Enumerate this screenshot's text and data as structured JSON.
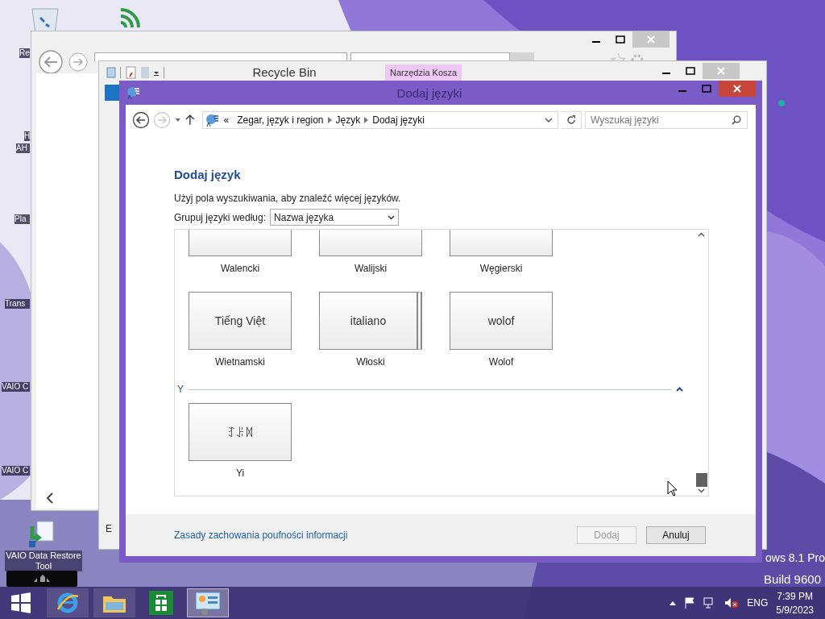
{
  "desktop": {
    "icons": [
      {
        "label": "Re"
      },
      {
        "label": "H"
      },
      {
        "label": "AH"
      },
      {
        "label": "Pla"
      },
      {
        "label": "Trans"
      },
      {
        "label": "VAIO C"
      },
      {
        "label": "VAIO C"
      },
      {
        "label": "VAIO Data Restore Tool"
      }
    ],
    "watermark_lines": [
      "ows 8.1 Pro",
      "Build 9600"
    ]
  },
  "recycle_window": {
    "title": "Recycle Bin",
    "context_tab": "Narzędzia Kosza",
    "status_text": "E"
  },
  "dialog": {
    "title": "Dodaj języki",
    "nav": {
      "back_enabled": true,
      "forward_enabled": false
    },
    "breadcrumb": {
      "overflow": "«",
      "items": [
        "Zegar, język i region",
        "Język",
        "Dodaj języki"
      ]
    },
    "search": {
      "placeholder": "Wyszukaj języki"
    },
    "heading": "Dodaj język",
    "hint": "Użyj pola wyszukiwania, aby znaleźć więcej języków.",
    "group_by": {
      "label": "Grupuj języki według:",
      "value": "Nazwa języka"
    },
    "groups": [
      {
        "tiles": [
          {
            "name": "Walencki",
            "cut": true,
            "stacked": false
          },
          {
            "name": "Walijski",
            "cut": true,
            "stacked": false
          },
          {
            "name": "Węgierski",
            "cut": true,
            "stacked": false
          }
        ]
      },
      {
        "tiles": [
          {
            "native": "Tiếng Việt",
            "name": "Wietnamski",
            "cut": false,
            "stacked": false
          },
          {
            "native": "italiano",
            "name": "Włoski",
            "cut": false,
            "stacked": true
          },
          {
            "native": "wolof",
            "name": "Wolof",
            "cut": false,
            "stacked": false
          }
        ]
      },
      {
        "header": "Y",
        "expanded": true,
        "tiles": [
          {
            "native": "ꆈꌠꉙ",
            "name": "Yi",
            "cut": false,
            "stacked": false
          }
        ]
      }
    ],
    "privacy_link": "Zasady zachowania poufności informacji",
    "buttons": [
      {
        "label": "Dodaj",
        "disabled": true
      },
      {
        "label": "Anuluj",
        "disabled": false
      }
    ]
  },
  "taskbar": {
    "apps": [
      {
        "kind": "browser",
        "selected": false
      },
      {
        "kind": "explorer",
        "selected": false
      },
      {
        "kind": "store",
        "selected": false
      },
      {
        "kind": "control-panel",
        "selected": true
      }
    ],
    "language": "ENG",
    "time": "7:39 PM",
    "date": "5/9/2023",
    "volume_muted": true
  }
}
